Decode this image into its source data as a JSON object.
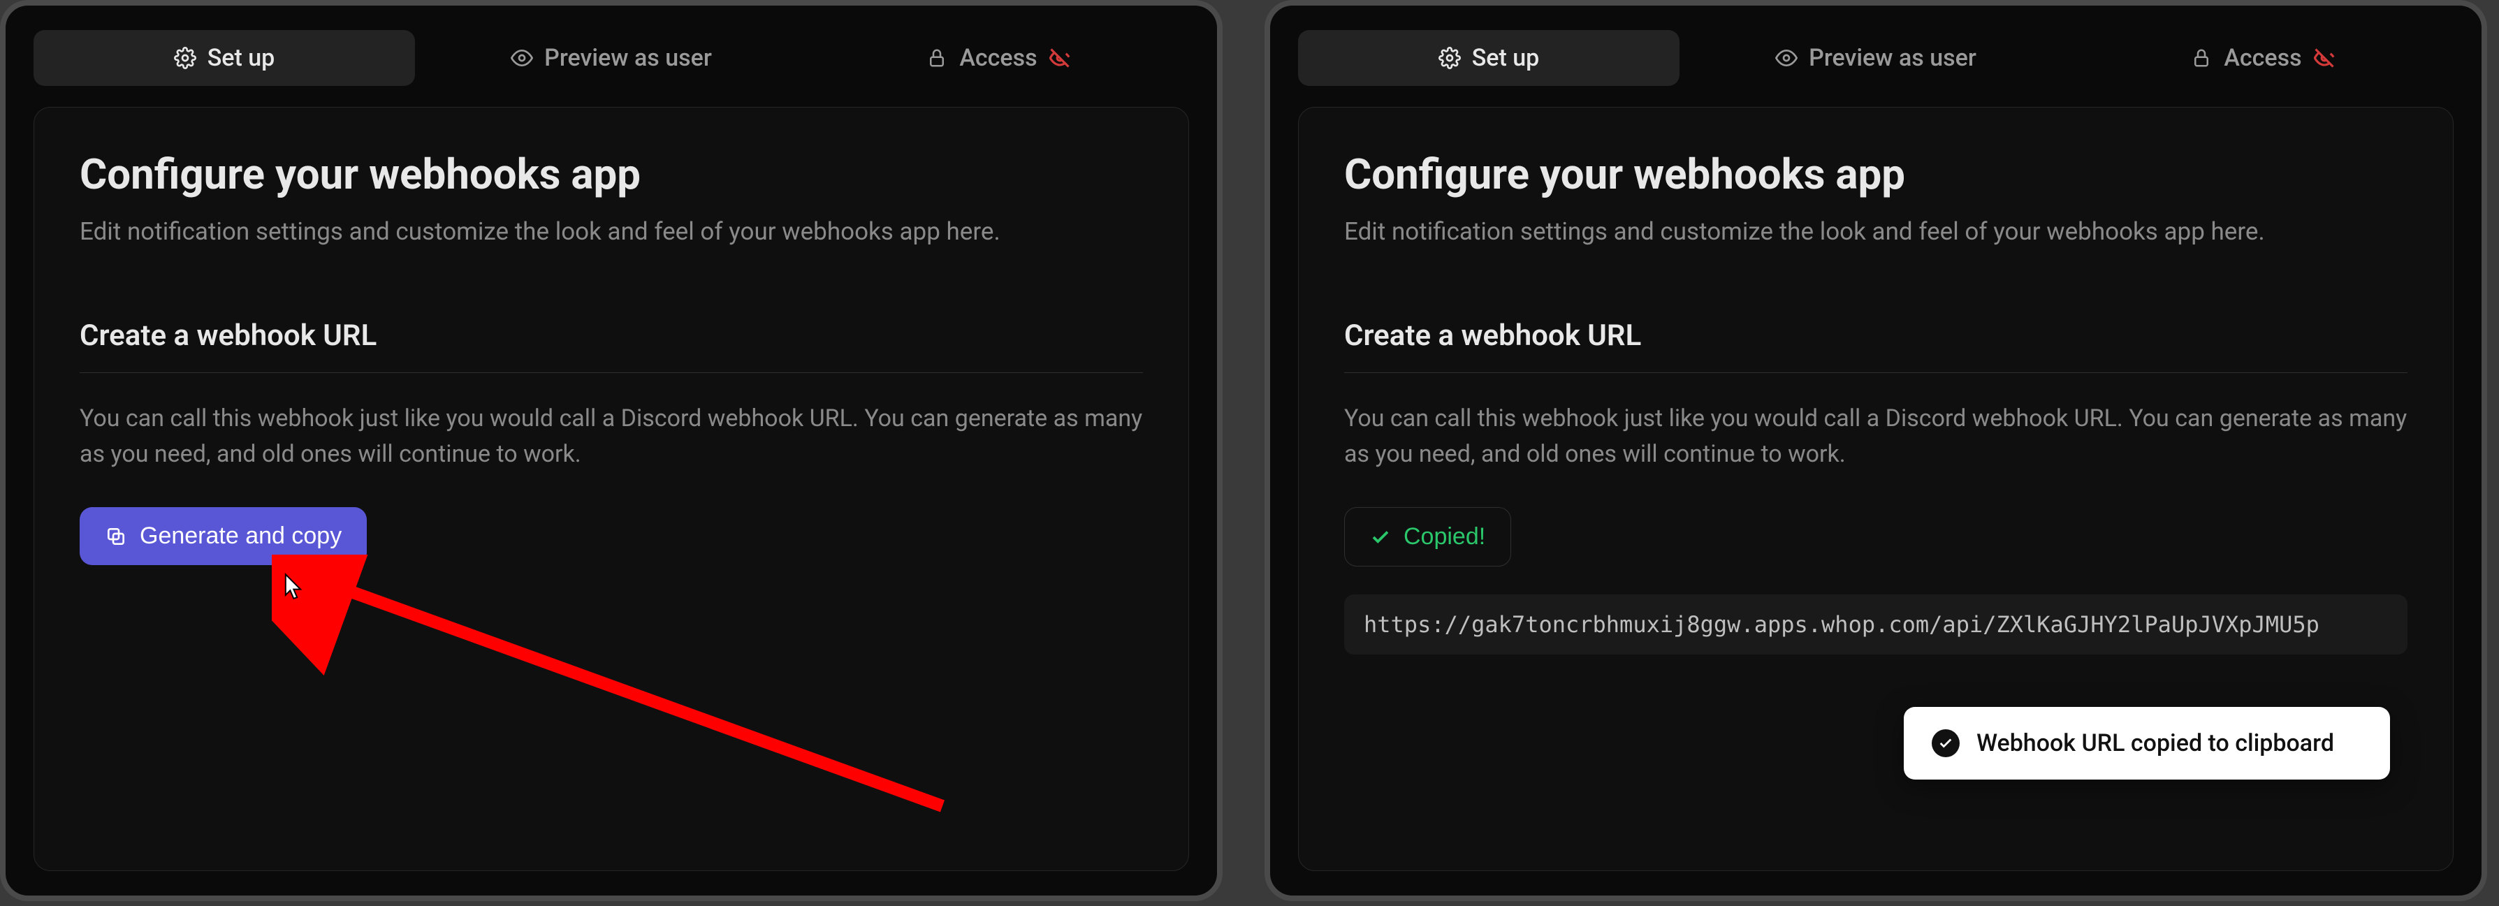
{
  "tabs": {
    "setup": "Set up",
    "preview": "Preview as user",
    "access": "Access"
  },
  "header": {
    "title": "Configure your webhooks app",
    "subtitle": "Edit notification settings and customize the look and feel of your webhooks app here."
  },
  "section": {
    "heading": "Create a webhook URL",
    "description": "You can call this webhook just like you would call a Discord webhook URL. You can generate as many as you need, and old ones will continue to work."
  },
  "buttons": {
    "generate": "Generate and copy",
    "copied": "Copied!"
  },
  "url": "https://gak7toncrbhmuxij8ggw.apps.whop.com/api/ZXlKaGJHY2lPaUpJVXpJMU5p",
  "toast": "Webhook URL copied to clipboard"
}
